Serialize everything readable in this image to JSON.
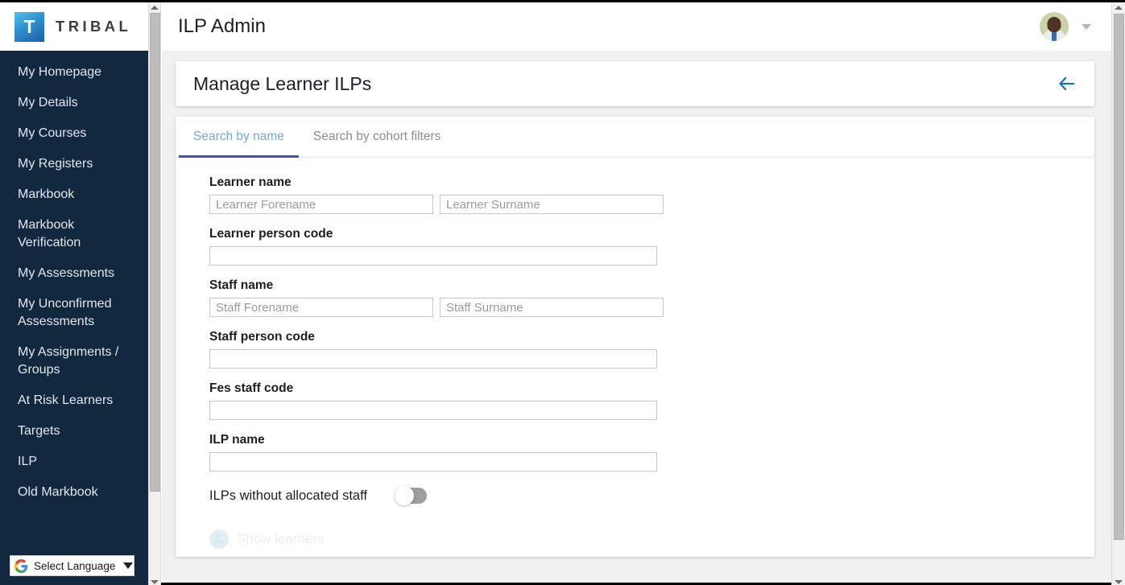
{
  "brand": {
    "mark_letter": "T",
    "name": "TRIBAL"
  },
  "sidebar": {
    "items": [
      {
        "label": "My Homepage"
      },
      {
        "label": "My Details"
      },
      {
        "label": "My Courses"
      },
      {
        "label": "My Registers"
      },
      {
        "label": "Markbook"
      },
      {
        "label": "Markbook Verification"
      },
      {
        "label": "My Assessments"
      },
      {
        "label": "My Unconfirmed Assessments"
      },
      {
        "label": "My Assignments / Groups"
      },
      {
        "label": "At Risk Learners"
      },
      {
        "label": "Targets"
      },
      {
        "label": "ILP"
      },
      {
        "label": "Old Markbook"
      }
    ],
    "language_widget": {
      "label": "Select Language",
      "icon": "google-g-icon",
      "caret": "chevron-down-icon"
    }
  },
  "topbar": {
    "title": "ILP Admin",
    "avatar_icon": "user-avatar",
    "caret_icon": "chevron-down-icon"
  },
  "card": {
    "title": "Manage Learner ILPs",
    "back_icon": "arrow-left-icon"
  },
  "tabs": [
    {
      "label": "Search by name",
      "active": true
    },
    {
      "label": "Search by cohort filters",
      "active": false
    }
  ],
  "form": {
    "learner_name": {
      "label": "Learner name",
      "forename": {
        "value": "",
        "placeholder": "Learner Forename"
      },
      "surname": {
        "value": "",
        "placeholder": "Learner Surname"
      }
    },
    "learner_person_code": {
      "label": "Learner person code",
      "value": "",
      "placeholder": ""
    },
    "staff_name": {
      "label": "Staff name",
      "forename": {
        "value": "",
        "placeholder": "Staff Forename"
      },
      "surname": {
        "value": "",
        "placeholder": "Staff Surname"
      }
    },
    "staff_person_code": {
      "label": "Staff person code",
      "value": "",
      "placeholder": ""
    },
    "fes_staff_code": {
      "label": "Fes staff code",
      "value": "",
      "placeholder": ""
    },
    "ilp_name": {
      "label": "ILP name",
      "value": "",
      "placeholder": ""
    },
    "toggle": {
      "label": "ILPs without allocated staff",
      "state": "off"
    },
    "submit": {
      "label": "Show learners",
      "icon": "person-search-icon",
      "disabled": true
    }
  },
  "colors": {
    "sidebar_bg": "#12283f",
    "tab_active_text": "#6eaadd",
    "tab_active_underline": "#3f51b5",
    "back_arrow": "#0a74a6",
    "toggle_track_off": "#9e9e9e"
  }
}
